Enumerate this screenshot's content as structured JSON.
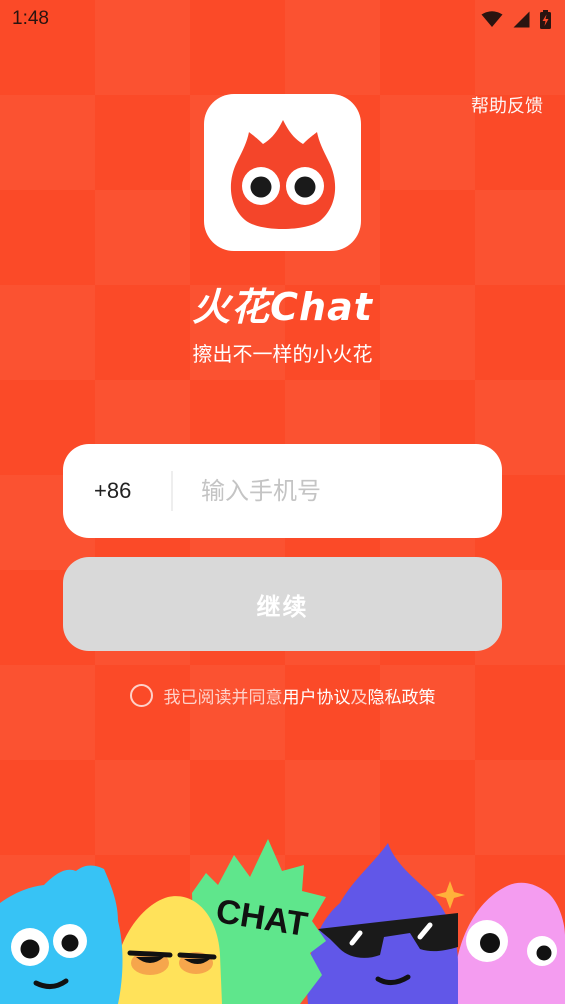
{
  "status_bar": {
    "time": "1:48",
    "icons": [
      "wifi-icon",
      "signal-icon",
      "battery-charging-icon"
    ]
  },
  "header": {
    "help_label": "帮助反馈"
  },
  "brand": {
    "logo_icon": "flame-mascot-icon",
    "title": "火花Chat",
    "slogan": "擦出不一样的小火花"
  },
  "login": {
    "country_code": "+86",
    "phone_value": "",
    "phone_placeholder": "输入手机号",
    "continue_label": "继续",
    "continue_enabled": false
  },
  "agreement": {
    "checked": false,
    "prefix": "我已阅读并同意",
    "user_agreement": "用户协议",
    "conjunction": "及",
    "privacy_policy": "隐私政策"
  },
  "illustration": {
    "mascot_text": "CHAT"
  },
  "colors": {
    "background": "#FB4A28",
    "logo_bg": "#FFFFFF",
    "flame": "#F4452A",
    "button_disabled": "#D9D9D9",
    "mascot_blue": "#37C3F5",
    "mascot_yellow": "#FFE25A",
    "mascot_green": "#5FE68C",
    "mascot_purple": "#6157E8",
    "mascot_pink": "#F49CF0"
  }
}
